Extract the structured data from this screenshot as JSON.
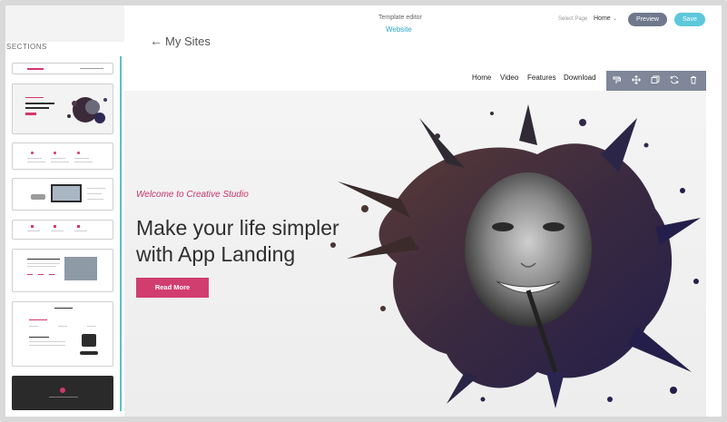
{
  "sidebar": {
    "title": "SECTIONS"
  },
  "topbar": {
    "title": "Template editor",
    "subtitle": "Website",
    "select_page_label": "Select Page",
    "select_page_value": "Home",
    "preview_label": "Preview",
    "save_label": "Save"
  },
  "back": {
    "label": "My Sites"
  },
  "site": {
    "nav": [
      "Home",
      "Video",
      "Features",
      "Download"
    ],
    "welcome": "Welcome to Creative Studio",
    "headline_line1": "Make your life simpler",
    "headline_line2": "with App Landing",
    "cta": "Read More"
  },
  "toolbar": {
    "icons": [
      "paint-roller-icon",
      "move-icon",
      "duplicate-icon",
      "refresh-icon",
      "delete-icon"
    ]
  },
  "colors": {
    "accent_pink": "#d23d6f",
    "accent_teal": "#5cc8da",
    "preview_btn": "#6f788c"
  }
}
